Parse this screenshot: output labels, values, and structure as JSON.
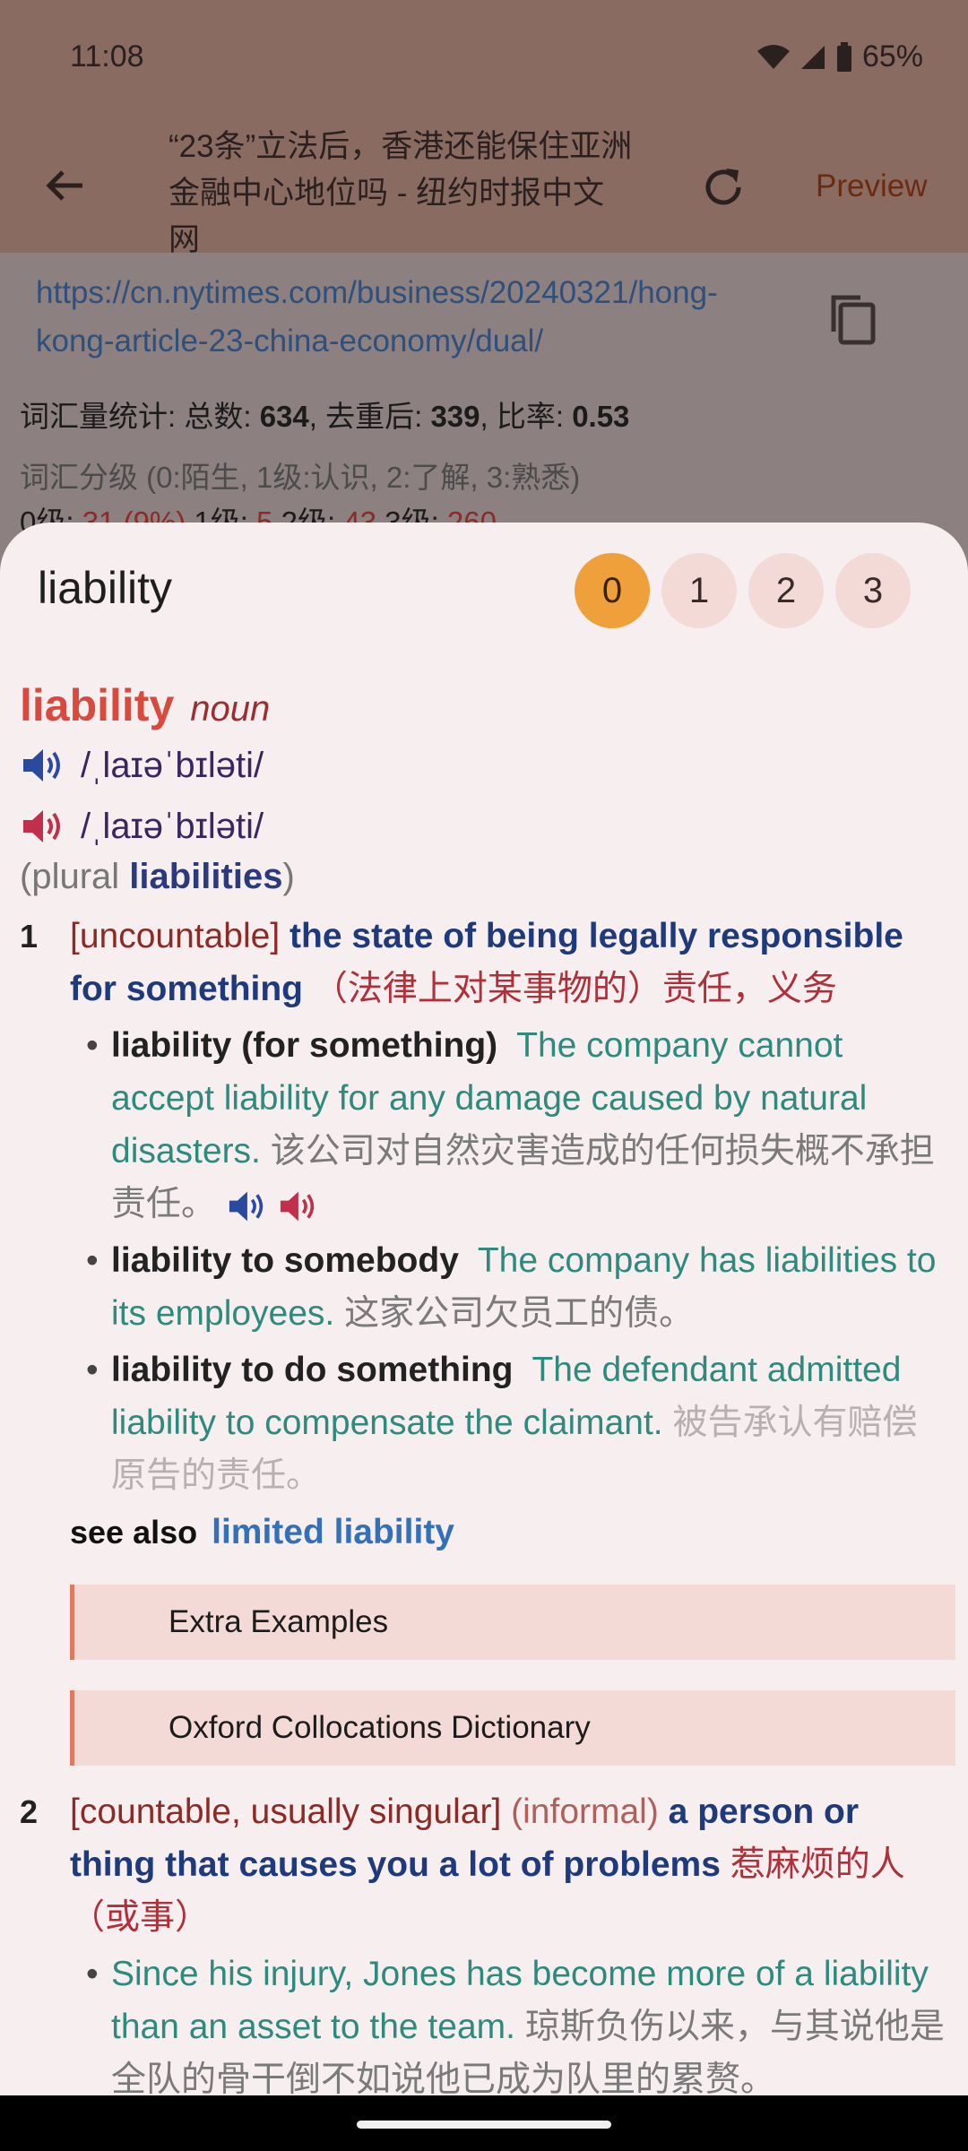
{
  "status": {
    "time": "11:08",
    "battery": "65%"
  },
  "background": {
    "title": "“23条”立法后，香港还能保住亚洲金融中心地位吗 - 纽约时报中文网",
    "preview_label": "Preview",
    "url": "https://cn.nytimes.com/business/20240321/hong-kong-article-23-china-economy/dual/",
    "stats_prefix": "词汇量统计: 总数: ",
    "stats_total": "634",
    "stats_mid1": ", 去重后: ",
    "stats_unique": "339",
    "stats_mid2": ", 比率: ",
    "stats_ratio": "0.53",
    "levels_legend": "词汇分级 (0:陌生, 1级:认识, 2:了解, 3:熟悉)",
    "lvl0_label": "0级: ",
    "lvl0_value": "31 (9%)",
    "lvl1_label": " 1级: ",
    "lvl1_value": "5",
    "lvl2_label": " 2级: ",
    "lvl2_value": "43",
    "lvl3_label": " 3级: ",
    "lvl3_value": "260"
  },
  "sheet": {
    "word": "liability",
    "levels": [
      "0",
      "1",
      "2",
      "3"
    ],
    "selected_level": "0"
  },
  "entry": {
    "headword": "liability",
    "pos": "noun",
    "pron_br": "/ˌlaɪəˈbɪləti/",
    "pron_us": "/ˌlaɪəˈbɪləti/",
    "plural_open": "(plural ",
    "plural_word": "liabilities",
    "plural_close": ")",
    "senses": [
      {
        "num": "1",
        "grammar": "[uncountable]",
        "definition": "the state of being legally responsible for something",
        "zh": "（法律上对某事物的）责任，义务",
        "examples": [
          {
            "kw": "liability (for something)",
            "en": "The company cannot accept liability for any damage caused by natural disasters.",
            "zh": "该公司对自然灾害造成的任何损失概不承担责任。"
          },
          {
            "kw": "liability to somebody",
            "en": "The company has liabilities to its employees.",
            "zh": "这家公司欠员工的债。"
          },
          {
            "kw": "liability to do something",
            "en": "The defendant admitted liability to compensate the claimant.",
            "zh": "被告承认有赔偿原告的责任。"
          }
        ],
        "see_also_label": "see also",
        "see_also_link": "limited liability",
        "extra_examples": "Extra Examples",
        "collocations": "Oxford Collocations Dictionary"
      },
      {
        "num": "2",
        "grammar": "[countable, usually singular]",
        "register": "(informal)",
        "definition": "a person or thing that causes you a lot of problems",
        "zh": "惹麻烦的人（或事）",
        "examples": [
          {
            "en": "Since his injury, Jones has become more of a liability than an asset to the team.",
            "zh": "琼斯负伤以来，与其说他是全队的骨干倒不如说他已成为队里的累赘。"
          }
        ]
      }
    ]
  },
  "colors": {
    "accent": "#f0a03a",
    "headword": "#d94a3e",
    "definition": "#1f3a7a",
    "example": "#2f8a7e",
    "zh": "#b0303a"
  }
}
